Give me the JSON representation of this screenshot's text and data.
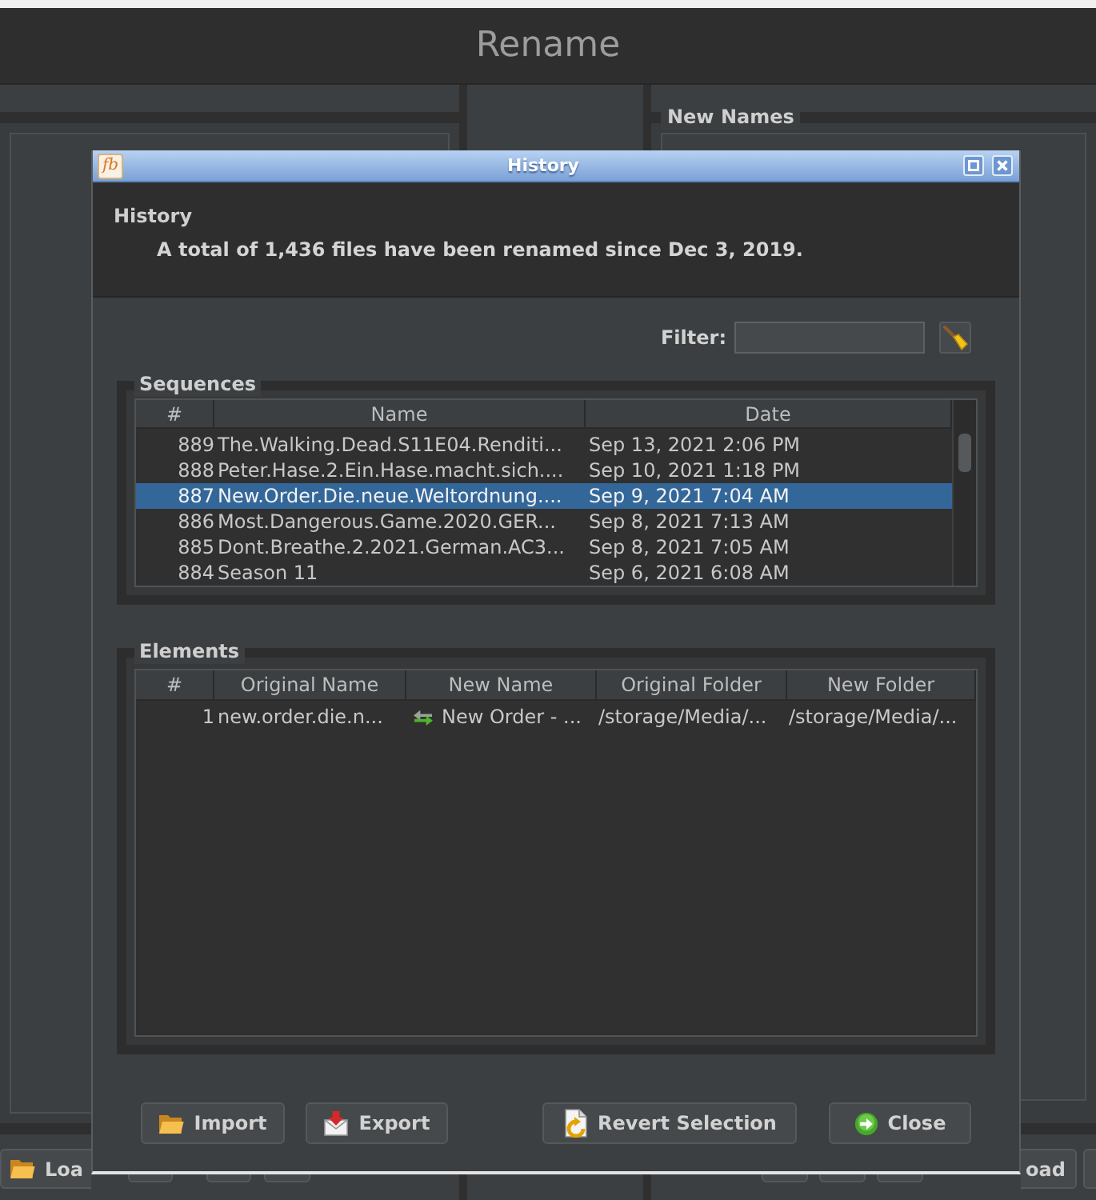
{
  "app": {
    "title": "Rename",
    "right_panel": {
      "title": "New Names"
    },
    "left_toolbar": {
      "button": "Loa"
    },
    "right_toolbar": {
      "button": "oad"
    }
  },
  "dialog": {
    "logo": "fb",
    "title": "History",
    "header": {
      "title": "History",
      "summary": "A total of 1,436 files have been renamed since Dec 3, 2019."
    },
    "filter": {
      "label": "Filter:"
    },
    "sequences": {
      "title": "Sequences",
      "columns": [
        "#",
        "Name",
        "Date"
      ],
      "rows": [
        {
          "number": "889",
          "name": "The.Walking.Dead.S11E04.Renditi...",
          "date": "Sep 13, 2021 2:06 PM",
          "selected": false
        },
        {
          "number": "888",
          "name": "Peter.Hase.2.Ein.Hase.macht.sich....",
          "date": "Sep 10, 2021 1:18 PM",
          "selected": false
        },
        {
          "number": "887",
          "name": "New.Order.Die.neue.Weltordnung....",
          "date": "Sep 9, 2021 7:04 AM",
          "selected": true
        },
        {
          "number": "886",
          "name": "Most.Dangerous.Game.2020.GER...",
          "date": "Sep 8, 2021 7:13 AM",
          "selected": false
        },
        {
          "number": "885",
          "name": "Dont.Breathe.2.2021.German.AC3...",
          "date": "Sep 8, 2021 7:05 AM",
          "selected": false
        },
        {
          "number": "884",
          "name": "Season 11",
          "date": "Sep 6, 2021 6:08 AM",
          "selected": false
        }
      ]
    },
    "elements": {
      "title": "Elements",
      "columns": [
        "#",
        "Original Name",
        "New Name",
        "Original Folder",
        "New Folder"
      ],
      "rows": [
        {
          "number": "1",
          "original_name": "new.order.die.n...",
          "new_name": "New Order - ...",
          "original_folder": "/storage/Media/...",
          "new_folder": "/storage/Media/..."
        }
      ]
    },
    "left_buttons": [
      {
        "kind": "import",
        "label": "Import"
      },
      {
        "kind": "export",
        "label": "Export"
      }
    ],
    "right_buttons": [
      {
        "kind": "revert",
        "label": "Revert Selection"
      },
      {
        "kind": "close",
        "label": "Close"
      }
    ]
  }
}
